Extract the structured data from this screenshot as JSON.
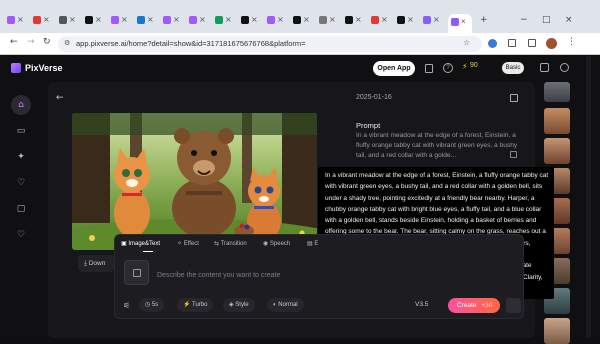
{
  "browser": {
    "url": "app.pixverse.ai/home?detail=show&id=317181675676768&platform=",
    "tab_icons": [
      "figma-icon",
      "video-icon",
      "tool-icon",
      "github-icon",
      "figma-icon",
      "bookmark-icon",
      "figma-icon",
      "figma-icon",
      "sheets-icon",
      "github-icon",
      "figma-icon",
      "github-icon",
      "close-icon",
      "cube-icon",
      "music-icon",
      "tiktok-icon",
      "pixverse-icon"
    ],
    "tab_close_glyph": "×",
    "new_tab_glyph": "+",
    "window_controls": [
      "−",
      "□",
      "×"
    ]
  },
  "app": {
    "brand": "PixVerse",
    "open_app_label": "Open App",
    "credits": "90",
    "plan_badge": "Basic",
    "sidebar_icons": [
      "home-icon",
      "video-icon",
      "sparkle-icon",
      "heart-shield-icon",
      "folder-icon",
      "heart-icon"
    ]
  },
  "detail": {
    "date": "2025-01-16",
    "prompt_heading": "Prompt",
    "prompt_short": "In a vibrant meadow at the edge of a forest, Einstein, a fluffy orange tabby cat with vibrant green eyes, a bushy tail, and a red collar with a golde...",
    "prompt_full": "In a vibrant meadow at the edge of a forest, Einstein, a fluffy orange tabby cat with vibrant green eyes, a bushy tail, and a red collar with a golden bell, sits under a shady tree, pointing excitedly at a friendly bear nearby. Harper, a chubby orange tabby cat with bright blue eyes, a fluffy tail, and a blue collar with a golden bell, stands beside Einstein, holding a basket of berries and offering some to the bear. The bear, sitting calmy on the grass, reaches out a paw with a big, friendly grin. The scene is filled with colorful wildflowers, dappled sunlight filtering through the trees, and a whimsical sense of connection between the animals. The art style is Ultra HDR, 3D intricate details, vibrant colors, realistic lighting, Dramatic Lighting, Enhanced Clarity, Brilliant Highlights, Hyper realistic Detailing, Pixar animation style.",
    "download_label": "Down"
  },
  "composer": {
    "tabs": [
      "Image&Text",
      "Effect",
      "Transition",
      "Speech",
      "E"
    ],
    "placeholder": "Describe the content you want to create",
    "duration": "5s",
    "turbo": "Turbo",
    "style": "Style",
    "quality": "Normal",
    "model": "V3.5",
    "create_label": "Create",
    "create_cost": "+30"
  }
}
